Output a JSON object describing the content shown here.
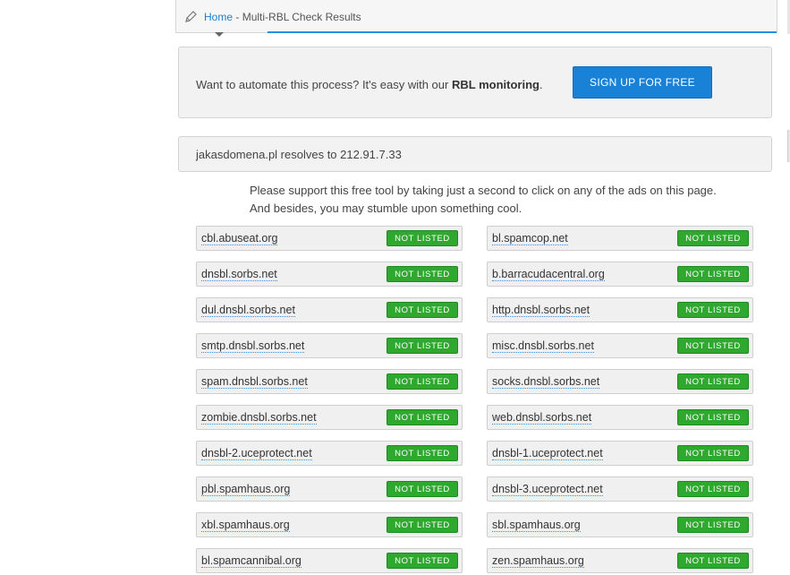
{
  "breadcrumb": {
    "home_label": "Home",
    "separator": "-",
    "current": "Multi-RBL Check Results"
  },
  "promo": {
    "text_before": "Want to automate this process? It's easy with our",
    "text_bold": "RBL monitoring",
    "text_after": ".",
    "signup_label": "SIGN UP FOR FREE"
  },
  "resolve": {
    "text": "jakasdomena.pl resolves to 212.91.7.33"
  },
  "support": {
    "line1": "Please support this free tool by taking just a second to click on any of the ads on this page.",
    "line2": "And besides, you may stumble upon something cool."
  },
  "colors": {
    "link": "#1f7ed0",
    "signup": "#1a82d6",
    "badge": "#2ea82e"
  },
  "results": [
    {
      "host": "cbl.abuseat.org",
      "status": "NOT LISTED"
    },
    {
      "host": "bl.spamcop.net",
      "status": "NOT LISTED"
    },
    {
      "host": "dnsbl.sorbs.net",
      "status": "NOT LISTED"
    },
    {
      "host": "b.barracudacentral.org",
      "status": "NOT LISTED"
    },
    {
      "host": "dul.dnsbl.sorbs.net",
      "status": "NOT LISTED"
    },
    {
      "host": "http.dnsbl.sorbs.net",
      "status": "NOT LISTED"
    },
    {
      "host": "smtp.dnsbl.sorbs.net",
      "status": "NOT LISTED"
    },
    {
      "host": "misc.dnsbl.sorbs.net",
      "status": "NOT LISTED"
    },
    {
      "host": "spam.dnsbl.sorbs.net",
      "status": "NOT LISTED"
    },
    {
      "host": "socks.dnsbl.sorbs.net",
      "status": "NOT LISTED"
    },
    {
      "host": "zombie.dnsbl.sorbs.net",
      "status": "NOT LISTED"
    },
    {
      "host": "web.dnsbl.sorbs.net",
      "status": "NOT LISTED"
    },
    {
      "host": "dnsbl-2.uceprotect.net",
      "status": "NOT LISTED"
    },
    {
      "host": "dnsbl-1.uceprotect.net",
      "status": "NOT LISTED"
    },
    {
      "host": "pbl.spamhaus.org",
      "status": "NOT LISTED"
    },
    {
      "host": "dnsbl-3.uceprotect.net",
      "status": "NOT LISTED"
    },
    {
      "host": "xbl.spamhaus.org",
      "status": "NOT LISTED"
    },
    {
      "host": "sbl.spamhaus.org",
      "status": "NOT LISTED"
    },
    {
      "host": "bl.spamcannibal.org",
      "status": "NOT LISTED"
    },
    {
      "host": "zen.spamhaus.org",
      "status": "NOT LISTED"
    }
  ]
}
